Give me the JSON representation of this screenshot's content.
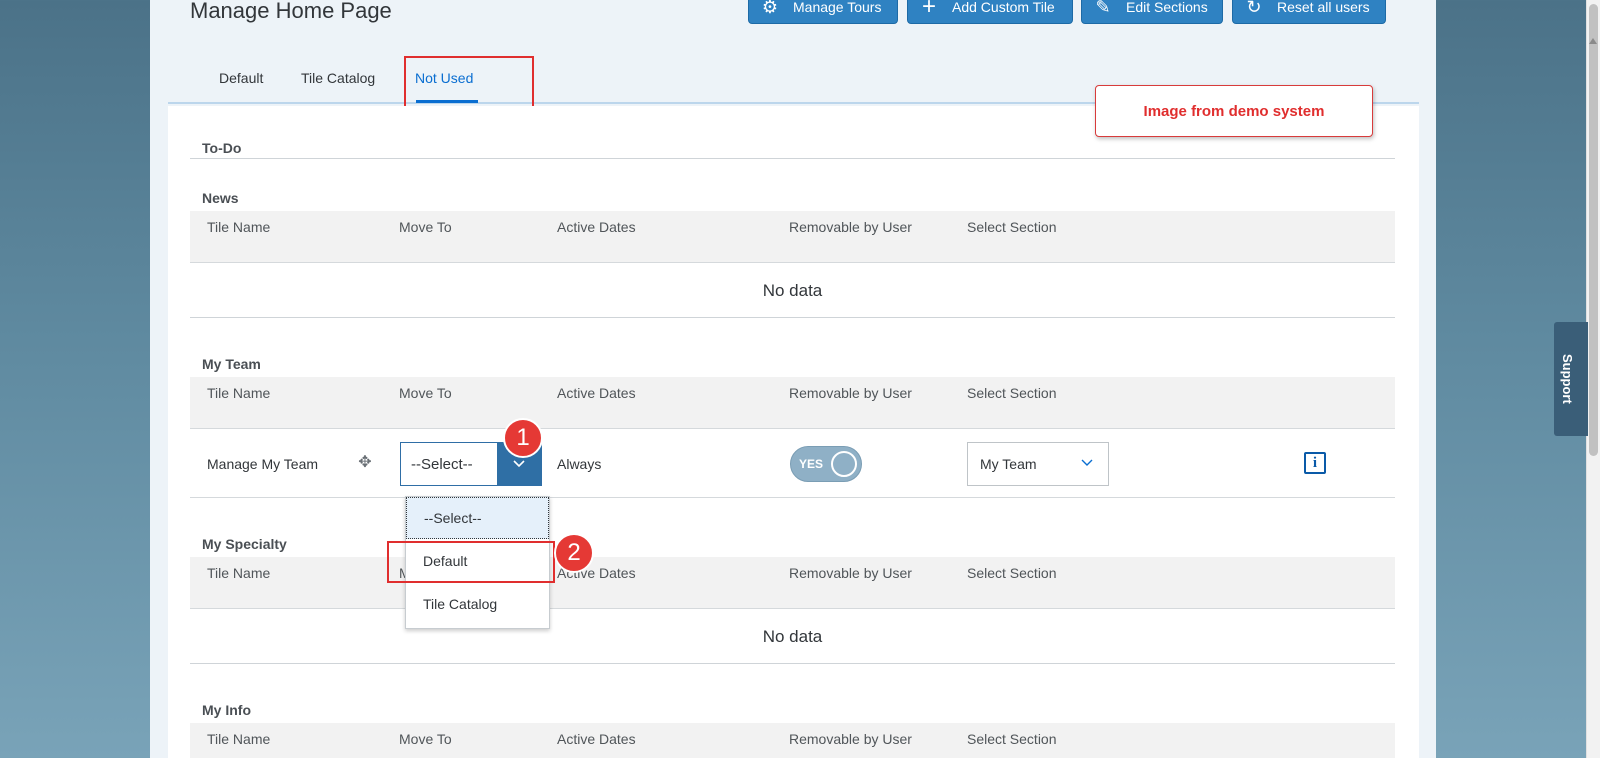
{
  "page": {
    "title": "Manage Home Page"
  },
  "toolbar": {
    "manage_tours": "Manage Tours",
    "add_custom_tile": "Add Custom Tile",
    "edit_sections": "Edit Sections",
    "reset_all_users": "Reset all users"
  },
  "tabs": [
    {
      "label": "Default"
    },
    {
      "label": "Tile Catalog"
    },
    {
      "label": "Not Used",
      "active": true
    }
  ],
  "note": "Image from demo system",
  "columns": [
    "Tile Name",
    "Move To",
    "Active Dates",
    "Removable by User",
    "Select Section"
  ],
  "sections": {
    "todo": {
      "title": "To-Do"
    },
    "news": {
      "title": "News",
      "empty_text": "No data"
    },
    "my_team": {
      "title": "My Team",
      "rows": [
        {
          "tile_name": "Manage My Team",
          "move_to": "--Select--",
          "active_dates": "Always",
          "removable": "YES",
          "section": "My Team"
        }
      ]
    },
    "my_specialty": {
      "title": "My Specialty",
      "empty_text": "No data"
    },
    "my_info": {
      "title": "My Info"
    }
  },
  "dropdown": {
    "options": [
      "--Select--",
      "Default",
      "Tile Catalog"
    ],
    "selected": "--Select--"
  },
  "callouts": {
    "one": "1",
    "two": "2"
  },
  "support": "Support",
  "colors": {
    "accent": "#0a6ed1",
    "button": "#2f82c2",
    "highlight": "#e02e2e"
  }
}
